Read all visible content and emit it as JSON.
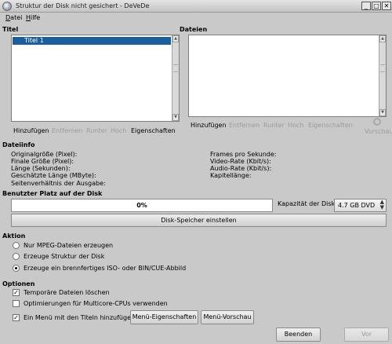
{
  "window": {
    "title": "Struktur der Disk nicht gesichert - DeVeDe",
    "buttons": {
      "minimize": "_",
      "maximize": "□",
      "close": "✕"
    }
  },
  "menu": {
    "file": "Datei",
    "help": "Hilfe"
  },
  "titles_section": {
    "label": "Titel",
    "items": [
      "Titel 1"
    ],
    "buttons": {
      "add": "Hinzufügen",
      "remove": "Entfernen",
      "down": "Runter",
      "up": "Hoch",
      "properties": "Eigenschaften"
    }
  },
  "files_section": {
    "label": "Dateien",
    "buttons": {
      "add": "Hinzufügen",
      "remove": "Entfernen",
      "down": "Runter",
      "up": "Hoch",
      "properties": "Eigenschaften",
      "preview": "Vorschau"
    }
  },
  "fileinfo": {
    "label": "Dateiinfo",
    "left": [
      "Originalgröße (Pixel):",
      "Finale Größe (Pixel):",
      "Länge (Sekunden):",
      "Geschätzte Länge (MByte):",
      "Seitenverhältnis der Ausgabe:"
    ],
    "right": [
      "Frames pro Sekunde:",
      "Video-Rate (Kbit/s):",
      "Audio-Rate (Kbit/s):",
      "Kapitellänge:"
    ]
  },
  "disk_usage": {
    "label": "Benutzter Platz auf der Disk",
    "percent": "0%",
    "capacity_label": "Kapazität der Disk:",
    "capacity_value": "4.7 GB DVD",
    "settings_button": "Disk-Speicher einstellen"
  },
  "action": {
    "label": "Aktion",
    "options": [
      {
        "label": "Nur MPEG-Dateien erzeugen",
        "checked": false
      },
      {
        "label": "Erzeuge Struktur der Disk",
        "checked": false
      },
      {
        "label": "Erzeuge ein brennfertiges ISO- oder BIN/CUE-Abbild",
        "checked": true
      }
    ]
  },
  "options": {
    "label": "Optionen",
    "temp_files": {
      "label": "Temporäre Dateien löschen",
      "checked": true
    },
    "multicore": {
      "label": "Optimierungen für Multicore-CPUs verwenden",
      "checked": false
    },
    "menu": {
      "label": "Ein Menü mit den Titeln hinzufügen",
      "checked": true
    },
    "menu_properties_button": "Menü-Eigenschaften",
    "menu_preview_button": "Menü-Vorschau"
  },
  "footer": {
    "quit": "Beenden",
    "next": "Vor"
  },
  "colors": {
    "selection": "#1b5e9c",
    "window_bg": "#c9c9c9"
  }
}
